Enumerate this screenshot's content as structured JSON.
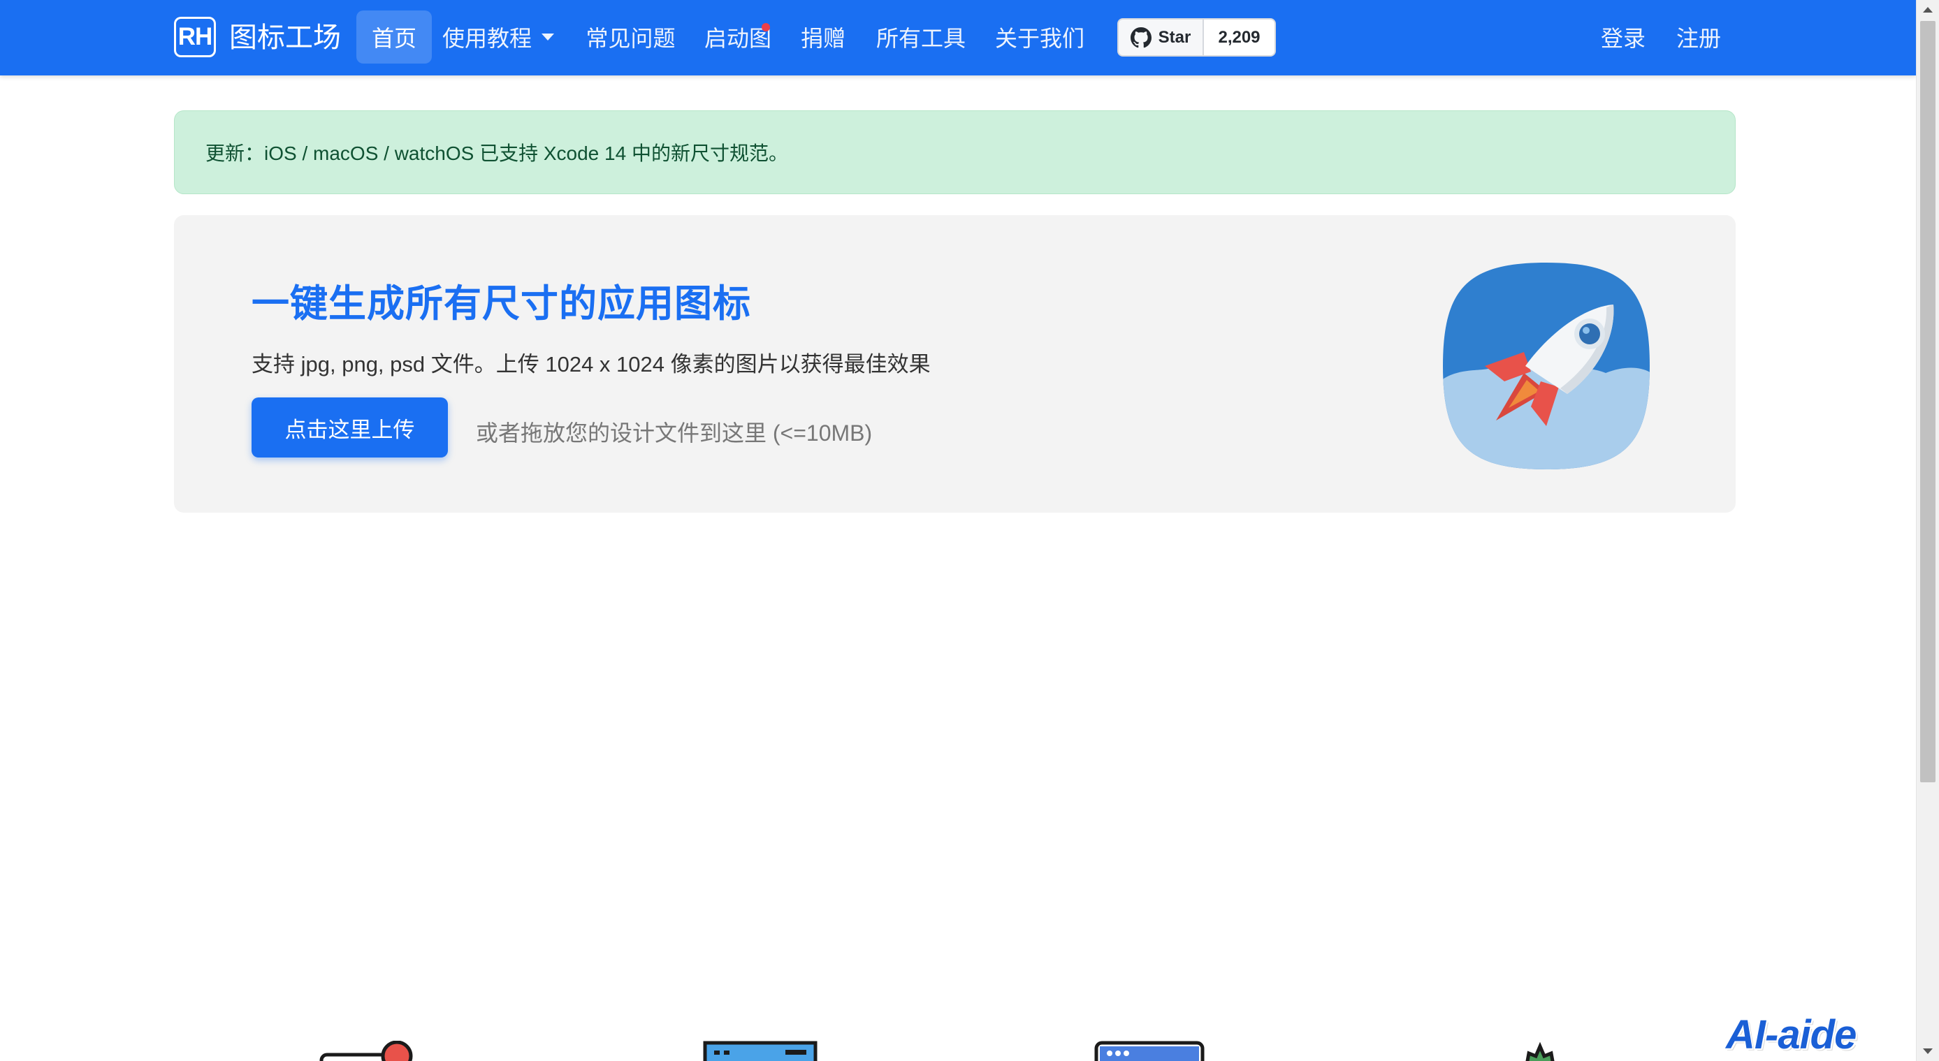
{
  "brand": {
    "badge": "RH",
    "name": "图标工场"
  },
  "nav": {
    "items": [
      {
        "label": "首页"
      },
      {
        "label": "使用教程"
      },
      {
        "label": "常见问题"
      },
      {
        "label": "启动图"
      },
      {
        "label": "捐赠"
      },
      {
        "label": "所有工具"
      },
      {
        "label": "关于我们"
      }
    ],
    "active": "首页",
    "github": {
      "star_label": "Star",
      "count": "2,209",
      "icon": "github-icon"
    },
    "login": "登录",
    "register": "注册"
  },
  "alert": {
    "text": "更新：iOS / macOS / watchOS 已支持 Xcode 14 中的新尺寸规范。"
  },
  "hero": {
    "title": "一键生成所有尺寸的应用图标",
    "description": "支持 jpg, png, psd 文件。上传 1024 x 1024 像素的图片以获得最佳效果",
    "upload_button": "点击这里上传",
    "drop_hint": "或者拖放您的设计文件到这里 (<=10MB)",
    "logo_icon": "rocket-icon"
  },
  "watermark": "AI-aide",
  "colors": {
    "primary": "#1a6ff2",
    "alert_bg": "#cdf0dc",
    "alert_text": "#0f5132",
    "hero_bg": "#f3f3f3"
  }
}
